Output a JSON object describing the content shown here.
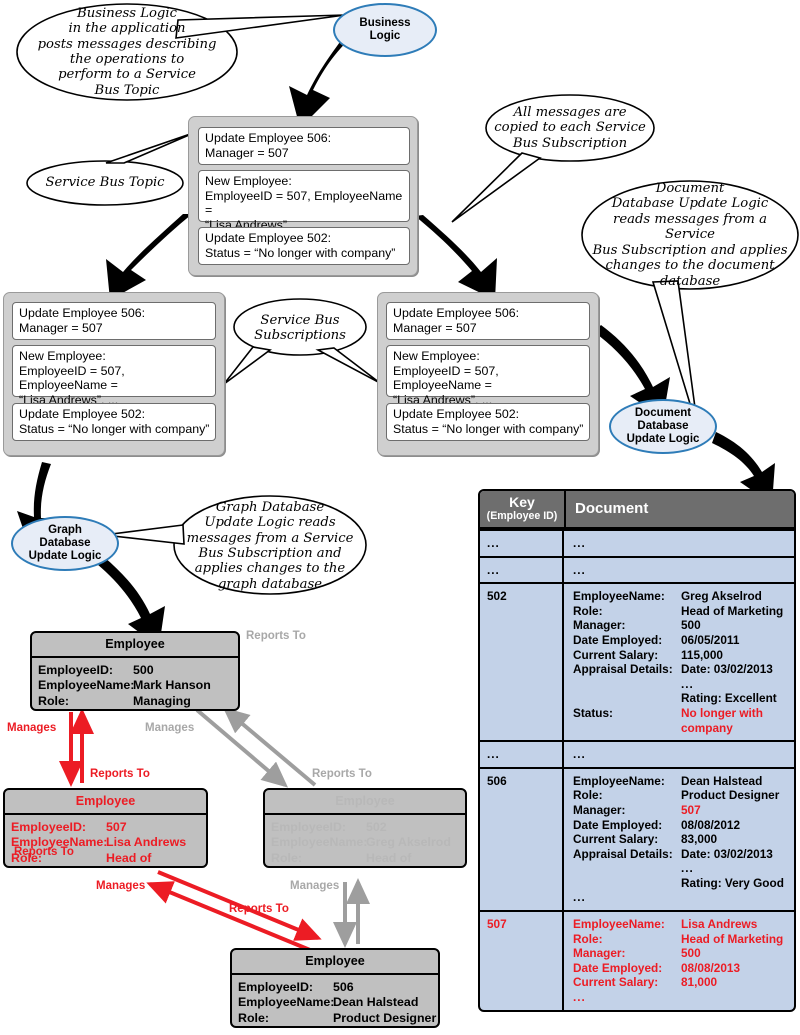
{
  "nodes": {
    "business_logic": "Business\nLogic",
    "document_db_logic": "Document\nDatabase\nUpdate Logic",
    "graph_db_logic": "Graph\nDatabase\nUpdate Logic"
  },
  "callouts": {
    "business_logic": "Business Logic\nin the application\nposts messages describing\nthe operations to\nperform to a Service\nBus Topic",
    "service_bus_topic": "Service Bus Topic",
    "all_messages": "All messages are\ncopied to each Service\nBus Subscription",
    "document_db": "Document\nDatabase Update Logic\nreads messages from a Service\nBus Subscription and applies\nchanges to the document\ndatabase",
    "service_bus_subscriptions": "Service Bus\nSubscriptions",
    "graph_db": "Graph Database\nUpdate Logic reads\nmessages from a Service\nBus Subscription and\napplies changes to the\ngraph database"
  },
  "messages": [
    {
      "line1": "Update  Employee 506:",
      "line2": "Manager = 507",
      "line3": ""
    },
    {
      "line1": "New  Employee:",
      "line2": "EmployeeID = 507, EmployeeName =",
      "line3": "“Lisa Andrews”, ..."
    },
    {
      "line1": "Update Employee 502:",
      "line2": "Status = “No longer with company”",
      "line3": ""
    }
  ],
  "entities": {
    "e500": {
      "title": "Employee",
      "rows": [
        {
          "k": "EmployeeID:",
          "v": "500"
        },
        {
          "k": "EmployeeName:",
          "v": "Mark Hanson"
        },
        {
          "k": "Role:",
          "v": "Managing Director"
        }
      ]
    },
    "e507": {
      "title": "Employee",
      "rows": [
        {
          "k": "EmployeeID:",
          "v": "507"
        },
        {
          "k": "EmployeeName:",
          "v": "Lisa Andrews"
        },
        {
          "k": "Role:",
          "v": "Head of Marketing"
        }
      ]
    },
    "e502": {
      "title": "Employee",
      "rows": [
        {
          "k": "EmployeeID:",
          "v": "502"
        },
        {
          "k": "EmployeeName:",
          "v": "Greg Akselrod"
        },
        {
          "k": "Role:",
          "v": "Head of Marketing"
        }
      ]
    },
    "e506": {
      "title": "Employee",
      "rows": [
        {
          "k": "EmployeeID:",
          "v": "506"
        },
        {
          "k": "EmployeeName:",
          "v": "Dean Halstead"
        },
        {
          "k": "Role:",
          "v": "Product Designer"
        }
      ]
    }
  },
  "edge_labels": {
    "manages_500_507": "Manages",
    "reports_507_500": "Reports To",
    "manages_500_502": "Manages",
    "reports_502_500": "Reports To",
    "manages_507_506": "Manages",
    "reports_506_507": "Reports To",
    "manages_502_506": "Manages",
    "reports_506_502": "Reports To",
    "reports_to_top": "Reports To"
  },
  "doc_table": {
    "header": {
      "key_line1": "Key",
      "key_line2": "(Employee ID)",
      "document": "Document"
    },
    "rows": [
      {
        "key": "...",
        "kind": "ellipsis",
        "doc": "..."
      },
      {
        "key": "...",
        "kind": "ellipsis",
        "doc": "..."
      },
      {
        "key": "502",
        "kind": "record",
        "key_red": false,
        "fields": [
          {
            "k": "EmployeeName:",
            "v": "Greg Akselrod",
            "red": false
          },
          {
            "k": "Role:",
            "v": "Head of Marketing",
            "red": false
          },
          {
            "k": "Manager:",
            "v": "500",
            "red": false
          },
          {
            "k": "Date Employed:",
            "v": "06/05/2011",
            "red": false
          },
          {
            "k": "Current Salary:",
            "v": "115,000",
            "red": false
          },
          {
            "k": "Appraisal Details:",
            "v": "Date:    03/02/2013",
            "red": false
          },
          {
            "k": "",
            "v": "...",
            "red": false
          },
          {
            "k": "",
            "v": "Rating: Excellent",
            "red": false
          },
          {
            "k": "Status:",
            "v": "No longer with company",
            "red": true
          }
        ]
      },
      {
        "key": "...",
        "kind": "ellipsis",
        "doc": "..."
      },
      {
        "key": "506",
        "kind": "record",
        "key_red": false,
        "fields": [
          {
            "k": "EmployeeName:",
            "v": "Dean Halstead",
            "red": false
          },
          {
            "k": "Role:",
            "v": "Product Designer",
            "red": false
          },
          {
            "k": "Manager:",
            "v": "507",
            "red": true
          },
          {
            "k": "Date Employed:",
            "v": "08/08/2012",
            "red": false
          },
          {
            "k": "Current Salary:",
            "v": "83,000",
            "red": false
          },
          {
            "k": "Appraisal Details:",
            "v": "Date:    03/02/2013",
            "red": false
          },
          {
            "k": "",
            "v": "...",
            "red": false
          },
          {
            "k": "",
            "v": "Rating: Very Good",
            "red": false
          },
          {
            "k": "...",
            "v": "",
            "red": false
          }
        ]
      },
      {
        "key": "507",
        "kind": "record",
        "key_red": true,
        "fields": [
          {
            "k": "EmployeeName:",
            "v": "Lisa Andrews",
            "red": true
          },
          {
            "k": "Role:",
            "v": "Head of Marketing",
            "red": true
          },
          {
            "k": "Manager:",
            "v": "500",
            "red": true
          },
          {
            "k": "Date Employed:",
            "v": "08/08/2013",
            "red": true
          },
          {
            "k": "Current Salary:",
            "v": "81,000",
            "red": true
          },
          {
            "k": "...",
            "v": "",
            "red": true
          }
        ]
      }
    ]
  },
  "colors": {
    "node_fill": "#e7edf7",
    "node_border": "#2e7cb8",
    "grey_container": "#cfcfcf",
    "entity_fill": "#c0c0c0",
    "table_header": "#6e6e6e",
    "table_cell": "#c3d2e8",
    "highlight_red": "#ec1c24",
    "muted_grey": "#b8b8b8"
  }
}
